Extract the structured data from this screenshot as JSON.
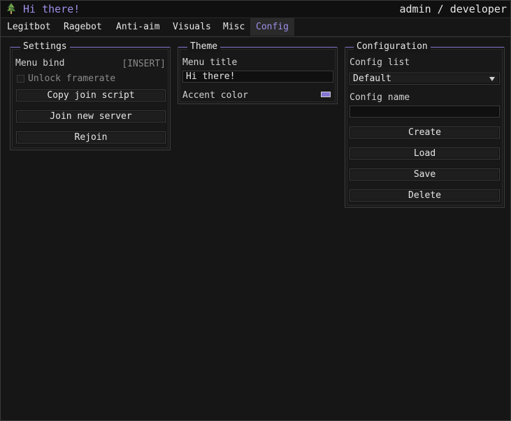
{
  "window": {
    "title": "Hi there!",
    "user": "admin / developer"
  },
  "tabs": [
    {
      "label": "Legitbot"
    },
    {
      "label": "Ragebot"
    },
    {
      "label": "Anti-aim"
    },
    {
      "label": "Visuals"
    },
    {
      "label": "Misc"
    },
    {
      "label": "Config",
      "active": true
    }
  ],
  "settings": {
    "title": "Settings",
    "menu_bind_label": "Menu bind",
    "menu_bind_value": "[INSERT]",
    "unlock_framerate_label": "Unlock framerate",
    "unlock_framerate_checked": false,
    "buttons": [
      "Copy join script",
      "Join new server",
      "Rejoin"
    ]
  },
  "theme": {
    "title": "Theme",
    "menu_title_label": "Menu title",
    "menu_title_value": "Hi there!",
    "accent_color_label": "Accent color",
    "accent_color": "#8577d4"
  },
  "configuration": {
    "title": "Configuration",
    "config_list_label": "Config list",
    "config_list_selected": "Default",
    "config_name_label": "Config name",
    "config_name_value": "",
    "buttons": [
      "Create",
      "Load",
      "Save",
      "Delete"
    ]
  },
  "colors": {
    "accent": "#9d8fe8",
    "background": "#161616"
  }
}
